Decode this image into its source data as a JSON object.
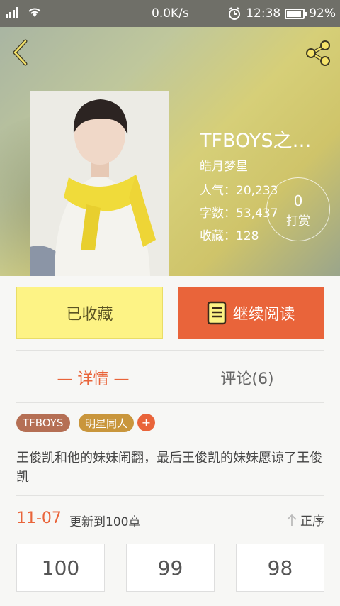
{
  "status_bar": {
    "network_speed": "0.0K/s",
    "time": "12:38",
    "battery": "92%",
    "battery_level": 0.92
  },
  "header": {
    "back_icon": "chevron-left-icon",
    "share_icon": "share-icon"
  },
  "book": {
    "title": "TFBOYS之…",
    "author": "皓月梦星",
    "popularity": "人气：20,233",
    "word_count": "字数：53,437",
    "favorites": "收藏：128",
    "tip_count": "0",
    "tip_label": "打赏"
  },
  "actions": {
    "collected_label": "已收藏",
    "continue_label": "继续阅读"
  },
  "tabs": [
    {
      "label": "— 详情 —",
      "active": true
    },
    {
      "label": "评论(6)",
      "active": false
    }
  ],
  "tags": [
    "TFBOYS",
    "明星同人",
    "+"
  ],
  "description": "王俊凯和他的妹妹闹翻，最后王俊凯的妹妹愿谅了王俊凯",
  "update": {
    "date": "11-07",
    "text": "更新到100章",
    "sort_label": "正序"
  },
  "chapters": [
    "100",
    "99",
    "98"
  ],
  "colors": {
    "accent": "#e9643a",
    "collected_bg": "#fdf385",
    "tag_1": "#b56f54",
    "tag_2": "#c9963c"
  }
}
